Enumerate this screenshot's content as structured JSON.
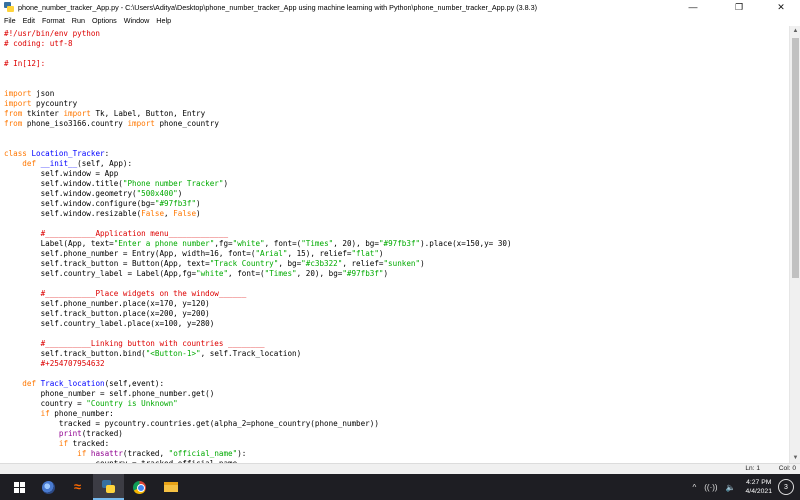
{
  "window": {
    "title": "phone_number_tracker_App.py - C:\\Users\\Aditya\\Desktop\\phone_number_tracker_App using machine learning with Python\\phone_number_tracker_App.py (3.8.3)"
  },
  "menu": [
    "File",
    "Edit",
    "Format",
    "Run",
    "Options",
    "Window",
    "Help"
  ],
  "editor": {
    "lines": [
      [
        [
          "comment",
          "#!/usr/bin/env python"
        ]
      ],
      [
        [
          "comment",
          "# coding: utf-8"
        ]
      ],
      [],
      [
        [
          "comment",
          "# In[12]:"
        ]
      ],
      [],
      [],
      [
        [
          "kw",
          "import"
        ],
        [
          "p",
          " json"
        ]
      ],
      [
        [
          "kw",
          "import"
        ],
        [
          "p",
          " pycountry"
        ]
      ],
      [
        [
          "kw",
          "from"
        ],
        [
          "p",
          " tkinter "
        ],
        [
          "kw",
          "import"
        ],
        [
          "p",
          " Tk, Label, Button, Entry"
        ]
      ],
      [
        [
          "kw",
          "from"
        ],
        [
          "p",
          " phone_iso3166.country "
        ],
        [
          "kw",
          "import"
        ],
        [
          "p",
          " phone_country"
        ]
      ],
      [],
      [],
      [
        [
          "kw",
          "class"
        ],
        [
          "p",
          " "
        ],
        [
          "def",
          "Location_Tracker"
        ],
        [
          "p",
          ":"
        ]
      ],
      [
        [
          "p",
          "    "
        ],
        [
          "kw",
          "def"
        ],
        [
          "p",
          " "
        ],
        [
          "def",
          "__init__"
        ],
        [
          "p",
          "(self, App):"
        ]
      ],
      [
        [
          "p",
          "        self.window = App"
        ]
      ],
      [
        [
          "p",
          "        self.window.title("
        ],
        [
          "str",
          "\"Phone number Tracker\""
        ],
        [
          "p",
          ")"
        ]
      ],
      [
        [
          "p",
          "        self.window.geometry("
        ],
        [
          "str",
          "\"500x400\""
        ],
        [
          "p",
          ")"
        ]
      ],
      [
        [
          "p",
          "        self.window.configure(bg="
        ],
        [
          "str",
          "\"#97fb3f\""
        ],
        [
          "p",
          ")"
        ]
      ],
      [
        [
          "p",
          "        self.window.resizable("
        ],
        [
          "kw",
          "False"
        ],
        [
          "p",
          ", "
        ],
        [
          "kw",
          "False"
        ],
        [
          "p",
          ")"
        ]
      ],
      [],
      [
        [
          "p",
          "        "
        ],
        [
          "comment",
          "#___________Application menu_____________"
        ]
      ],
      [
        [
          "p",
          "        Label(App, text="
        ],
        [
          "str",
          "\"Enter a phone number\""
        ],
        [
          "p",
          ",fg="
        ],
        [
          "str",
          "\"white\""
        ],
        [
          "p",
          ", font=("
        ],
        [
          "str",
          "\"Times\""
        ],
        [
          "p",
          ", 20), bg="
        ],
        [
          "str",
          "\"#97fb3f\""
        ],
        [
          "p",
          ").place(x=150,y= 30)"
        ]
      ],
      [
        [
          "p",
          "        self.phone_number = Entry(App, width=16, font=("
        ],
        [
          "str",
          "\"Arial\""
        ],
        [
          "p",
          ", 15), relief="
        ],
        [
          "str",
          "\"flat\""
        ],
        [
          "p",
          ")"
        ]
      ],
      [
        [
          "p",
          "        self.track_button = Button(App, text="
        ],
        [
          "str",
          "\"Track Country\""
        ],
        [
          "p",
          ", bg="
        ],
        [
          "str",
          "\"#c3b322\""
        ],
        [
          "p",
          ", relief="
        ],
        [
          "str",
          "\"sunken\""
        ],
        [
          "p",
          ")"
        ]
      ],
      [
        [
          "p",
          "        self.country_label = Label(App,fg="
        ],
        [
          "str",
          "\"white\""
        ],
        [
          "p",
          ", font=("
        ],
        [
          "str",
          "\"Times\""
        ],
        [
          "p",
          ", 20), bg="
        ],
        [
          "str",
          "\"#97fb3f\""
        ],
        [
          "p",
          ")"
        ]
      ],
      [],
      [
        [
          "p",
          "        "
        ],
        [
          "comment",
          "#___________Place widgets on the window______"
        ]
      ],
      [
        [
          "p",
          "        self.phone_number.place(x=170, y=120)"
        ]
      ],
      [
        [
          "p",
          "        self.track_button.place(x=200, y=200)"
        ]
      ],
      [
        [
          "p",
          "        self.country_label.place(x=100, y=280)"
        ]
      ],
      [],
      [
        [
          "p",
          "        "
        ],
        [
          "comment",
          "#__________Linking button with countries ________"
        ]
      ],
      [
        [
          "p",
          "        self.track_button.bind("
        ],
        [
          "str",
          "\"<Button-1>\""
        ],
        [
          "p",
          ", self.Track_location)"
        ]
      ],
      [
        [
          "p",
          "        "
        ],
        [
          "comment",
          "#+254707954632"
        ]
      ],
      [],
      [
        [
          "p",
          "    "
        ],
        [
          "kw",
          "def"
        ],
        [
          "p",
          " "
        ],
        [
          "def",
          "Track_location"
        ],
        [
          "p",
          "(self,event):"
        ]
      ],
      [
        [
          "p",
          "        phone_number = self.phone_number.get()"
        ]
      ],
      [
        [
          "p",
          "        country = "
        ],
        [
          "str",
          "\"Country is Unknown\""
        ]
      ],
      [
        [
          "p",
          "        "
        ],
        [
          "kw",
          "if"
        ],
        [
          "p",
          " phone_number:"
        ]
      ],
      [
        [
          "p",
          "            tracked = pycountry.countries.get(alpha_2=phone_country(phone_number))"
        ]
      ],
      [
        [
          "p",
          "            "
        ],
        [
          "bi",
          "print"
        ],
        [
          "p",
          "(tracked)"
        ]
      ],
      [
        [
          "p",
          "            "
        ],
        [
          "kw",
          "if"
        ],
        [
          "p",
          " tracked:"
        ]
      ],
      [
        [
          "p",
          "                "
        ],
        [
          "kw",
          "if"
        ],
        [
          "p",
          " "
        ],
        [
          "bi",
          "hasattr"
        ],
        [
          "p",
          "(tracked, "
        ],
        [
          "str",
          "\"official_name\""
        ],
        [
          "p",
          "):"
        ]
      ],
      [
        [
          "p",
          "                    country = tracked.official_name"
        ]
      ]
    ]
  },
  "statusbar": {
    "line": "Ln: 1",
    "col": "Col: 0"
  },
  "taskbar": {
    "clock_time": "4:27 PM",
    "clock_date": "4/4/2021",
    "notification_count": "3",
    "tray_chevron": "^",
    "tray_wifi": "((·))",
    "tray_volume": "🔈"
  }
}
